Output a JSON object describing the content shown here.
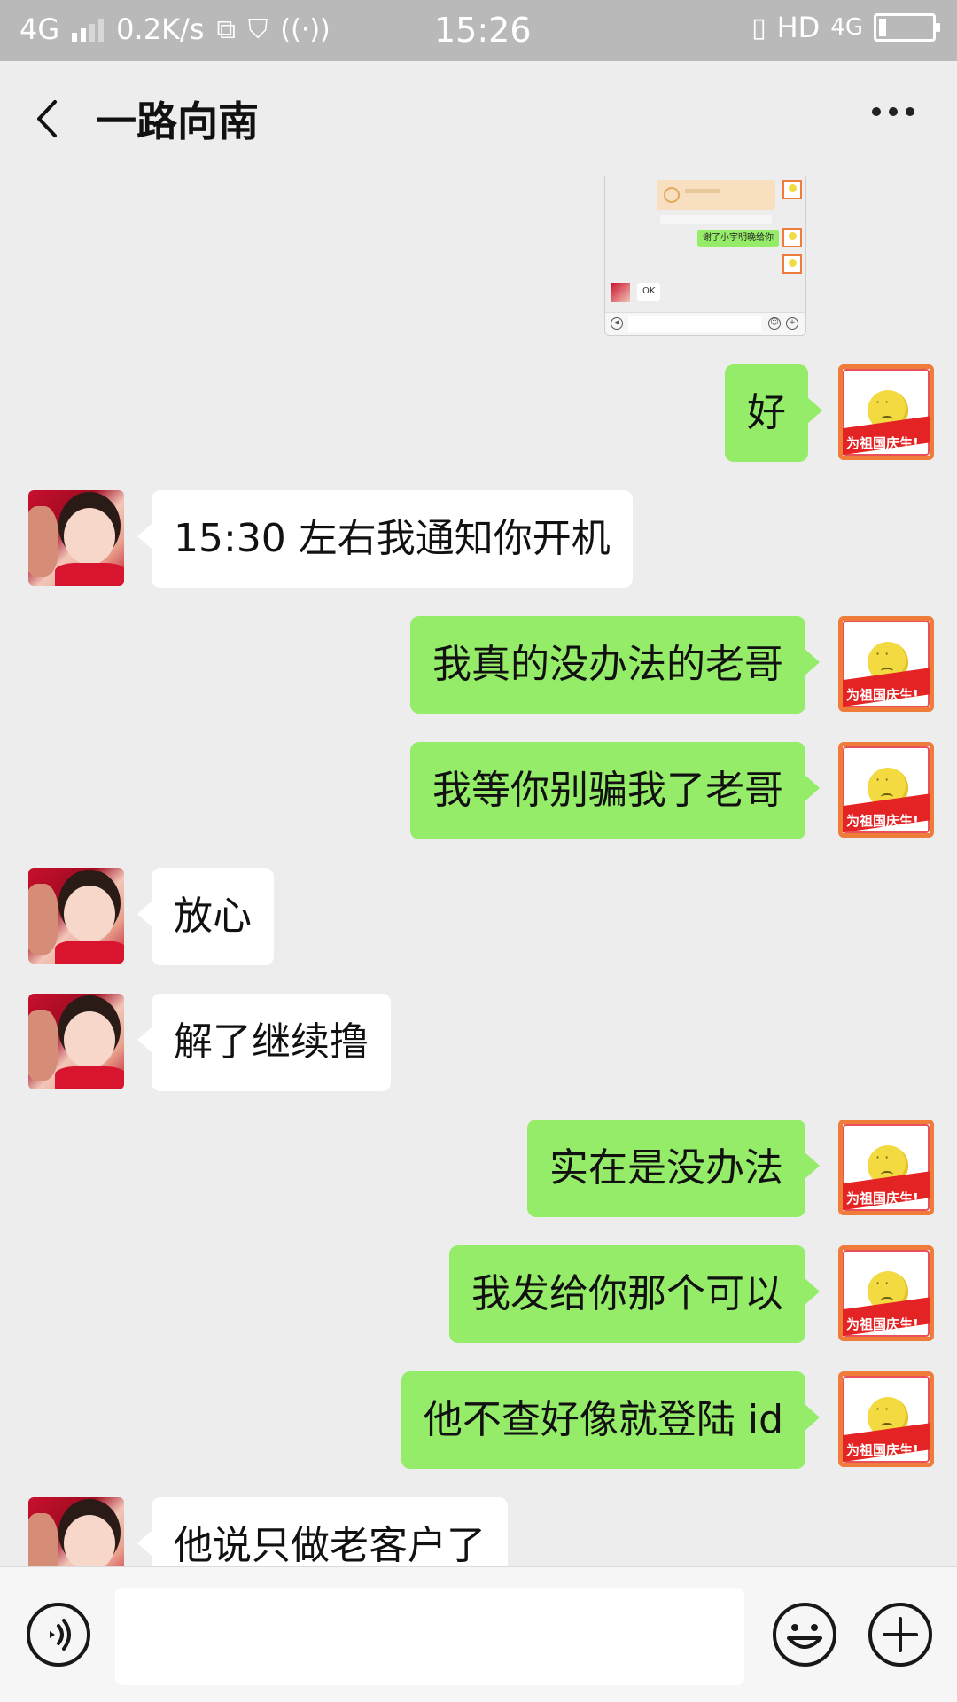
{
  "status_bar": {
    "network": "4G",
    "speed": "0.2K/s",
    "time": "15:26",
    "hd": "HD",
    "network_right": "4G"
  },
  "header": {
    "title": "一路向南"
  },
  "thumbnail": {
    "msg1": "谢了小宇明晚给你",
    "msg2": "OK"
  },
  "avatar_badge": "为祖国庆生!",
  "messages": [
    {
      "side": "me",
      "text": "好"
    },
    {
      "side": "them",
      "text": "15:30 左右我通知你开机"
    },
    {
      "side": "me",
      "text": "我真的没办法的老哥"
    },
    {
      "side": "me",
      "text": "我等你别骗我了老哥"
    },
    {
      "side": "them",
      "text": "放心"
    },
    {
      "side": "them",
      "text": "解了继续撸"
    },
    {
      "side": "me",
      "text": "实在是没办法"
    },
    {
      "side": "me",
      "text": "我发给你那个可以"
    },
    {
      "side": "me",
      "text": "他不查好像就登陆 id"
    },
    {
      "side": "them",
      "text": "他说只做老客户了"
    }
  ],
  "colors": {
    "my_bubble": "#95ec69",
    "their_bubble": "#ffffff",
    "chat_bg": "#ededed",
    "status_bar": "#b9b9b9"
  },
  "icons": {
    "back": "chevron-left-icon",
    "more": "more-dots-icon",
    "voice": "voice-icon",
    "emoji": "emoji-icon",
    "plus": "plus-icon"
  }
}
